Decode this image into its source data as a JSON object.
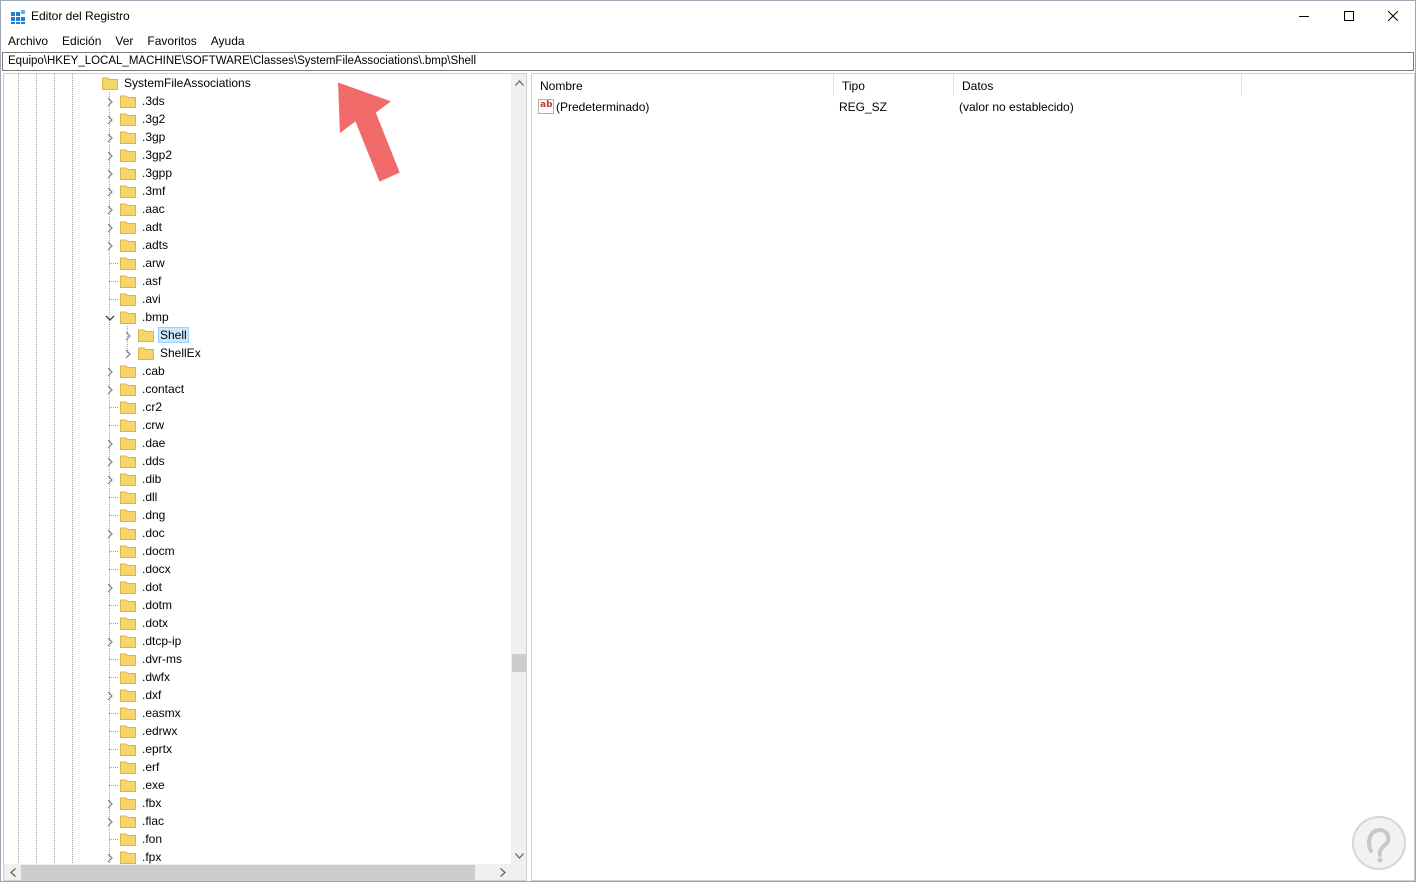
{
  "window": {
    "title": "Editor del Registro"
  },
  "menu": [
    "Archivo",
    "Edición",
    "Ver",
    "Favoritos",
    "Ayuda"
  ],
  "address": "Equipo\\HKEY_LOCAL_MACHINE\\SOFTWARE\\Classes\\SystemFileAssociations\\.bmp\\Shell",
  "tree": {
    "root": {
      "label": "SystemFileAssociations",
      "expanded": true
    },
    "items": [
      {
        "label": ".3ds",
        "has_children": true
      },
      {
        "label": ".3g2",
        "has_children": true
      },
      {
        "label": ".3gp",
        "has_children": true
      },
      {
        "label": ".3gp2",
        "has_children": true
      },
      {
        "label": ".3gpp",
        "has_children": true
      },
      {
        "label": ".3mf",
        "has_children": true
      },
      {
        "label": ".aac",
        "has_children": true
      },
      {
        "label": ".adt",
        "has_children": true
      },
      {
        "label": ".adts",
        "has_children": true
      },
      {
        "label": ".arw",
        "has_children": false
      },
      {
        "label": ".asf",
        "has_children": false
      },
      {
        "label": ".avi",
        "has_children": false
      },
      {
        "label": ".bmp",
        "has_children": true,
        "expanded": true
      },
      {
        "label": "Shell",
        "has_children": true,
        "child": true,
        "selected": true
      },
      {
        "label": "ShellEx",
        "has_children": true,
        "child": true
      },
      {
        "label": ".cab",
        "has_children": true
      },
      {
        "label": ".contact",
        "has_children": true
      },
      {
        "label": ".cr2",
        "has_children": false
      },
      {
        "label": ".crw",
        "has_children": false
      },
      {
        "label": ".dae",
        "has_children": true
      },
      {
        "label": ".dds",
        "has_children": true
      },
      {
        "label": ".dib",
        "has_children": true
      },
      {
        "label": ".dll",
        "has_children": false
      },
      {
        "label": ".dng",
        "has_children": false
      },
      {
        "label": ".doc",
        "has_children": true
      },
      {
        "label": ".docm",
        "has_children": false
      },
      {
        "label": ".docx",
        "has_children": false
      },
      {
        "label": ".dot",
        "has_children": true
      },
      {
        "label": ".dotm",
        "has_children": false
      },
      {
        "label": ".dotx",
        "has_children": false
      },
      {
        "label": ".dtcp-ip",
        "has_children": true
      },
      {
        "label": ".dvr-ms",
        "has_children": false
      },
      {
        "label": ".dwfx",
        "has_children": false
      },
      {
        "label": ".dxf",
        "has_children": true
      },
      {
        "label": ".easmx",
        "has_children": false
      },
      {
        "label": ".edrwx",
        "has_children": false
      },
      {
        "label": ".eprtx",
        "has_children": false
      },
      {
        "label": ".erf",
        "has_children": false
      },
      {
        "label": ".exe",
        "has_children": false
      },
      {
        "label": ".fbx",
        "has_children": true
      },
      {
        "label": ".flac",
        "has_children": true
      },
      {
        "label": ".fon",
        "has_children": false
      },
      {
        "label": ".fpx",
        "has_children": true
      }
    ]
  },
  "values": {
    "columns": [
      "Nombre",
      "Tipo",
      "Datos"
    ],
    "rows": [
      {
        "name": "(Predeterminado)",
        "type": "REG_SZ",
        "data": "(valor no establecido)",
        "icon": "ab-string-icon"
      }
    ]
  },
  "colors": {
    "folder": "#f6d66b",
    "selection": "#cce8ff",
    "annotation_arrow": "#f26b6b"
  }
}
